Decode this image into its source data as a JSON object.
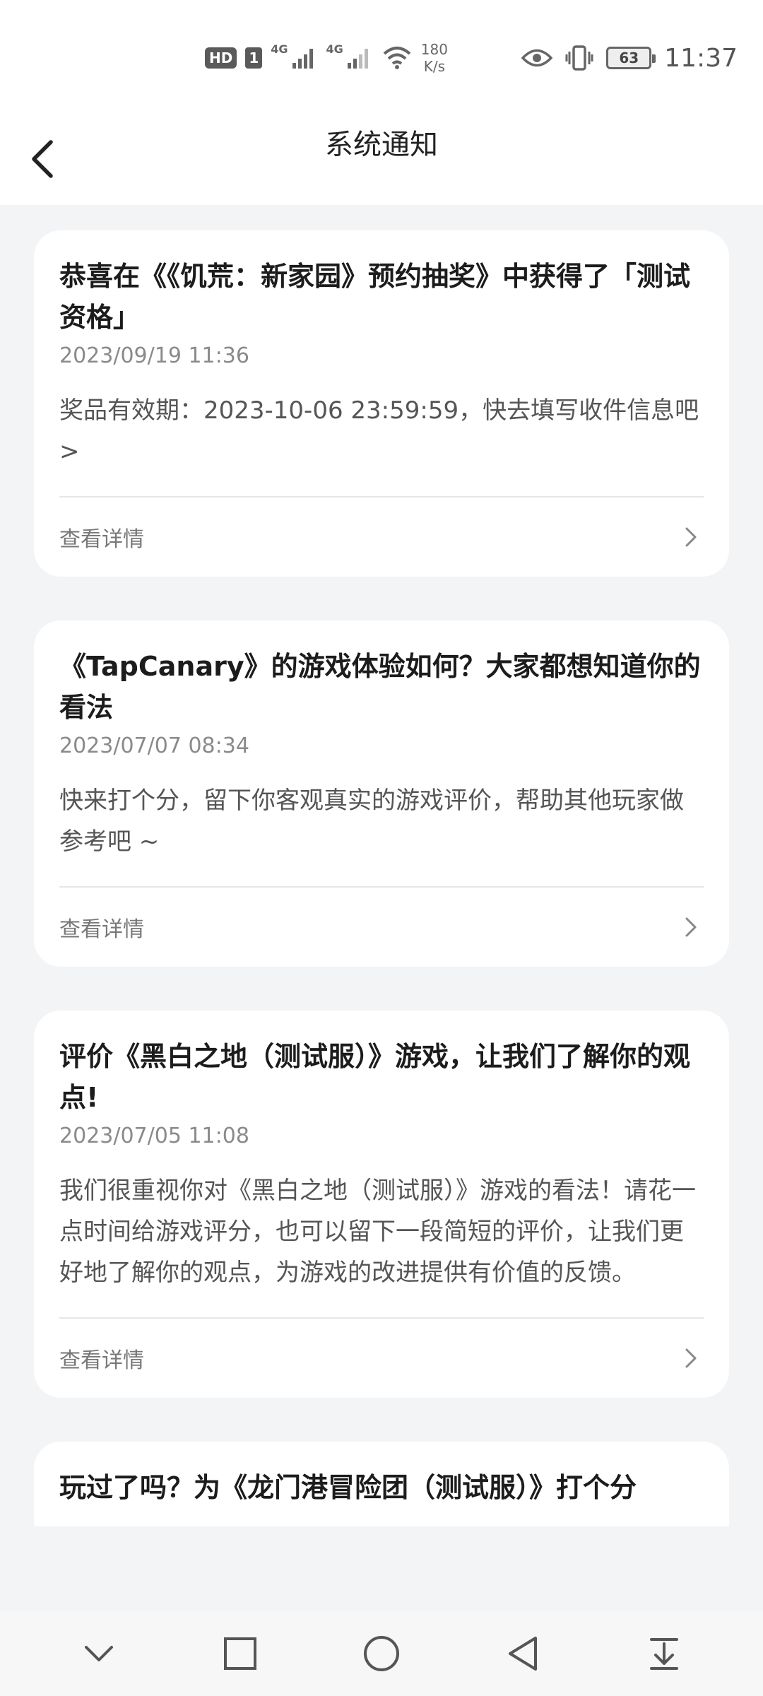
{
  "status_bar": {
    "hd": "HD",
    "sim1": "1",
    "net1": "4G",
    "net2": "4G",
    "speed_value": "180",
    "speed_unit": "K/s",
    "battery": "63",
    "time": "11:37"
  },
  "header": {
    "title": "系统通知"
  },
  "notifications": [
    {
      "title": "恭喜在《《饥荒：新家园》预约抽奖》中获得了「测试资格」",
      "date": "2023/09/19 11:36",
      "body": "奖品有效期：2023-10-06 23:59:59，快去填写收件信息吧>",
      "detail_label": "查看详情"
    },
    {
      "title": "《TapCanary》的游戏体验如何？大家都想知道你的看法",
      "date": "2023/07/07 08:34",
      "body": "快来打个分，留下你客观真实的游戏评价，帮助其他玩家做参考吧 ~",
      "detail_label": "查看详情"
    },
    {
      "title": "评价《黑白之地（测试服）》游戏，让我们了解你的观点!",
      "date": "2023/07/05 11:08",
      "body": "我们很重视你对《黑白之地（测试服）》游戏的看法！请花一点时间给游戏评分，也可以留下一段简短的评价，让我们更好地了解你的观点，为游戏的改进提供有价值的反馈。",
      "detail_label": "查看详情"
    },
    {
      "title": "玩过了吗？为《龙门港冒险团（测试服）》打个分"
    }
  ],
  "icons": {
    "back": "chevron-left-icon",
    "detail_arrow": "chevron-right-icon",
    "eye": "eye-icon",
    "vibrate": "vibrate-icon",
    "wifi": "wifi-icon",
    "signal": "signal-icon",
    "nav_hide": "chevron-down-icon",
    "nav_recent": "square-icon",
    "nav_home": "circle-icon",
    "nav_back": "triangle-back-icon",
    "nav_notifications": "pull-down-icon"
  }
}
